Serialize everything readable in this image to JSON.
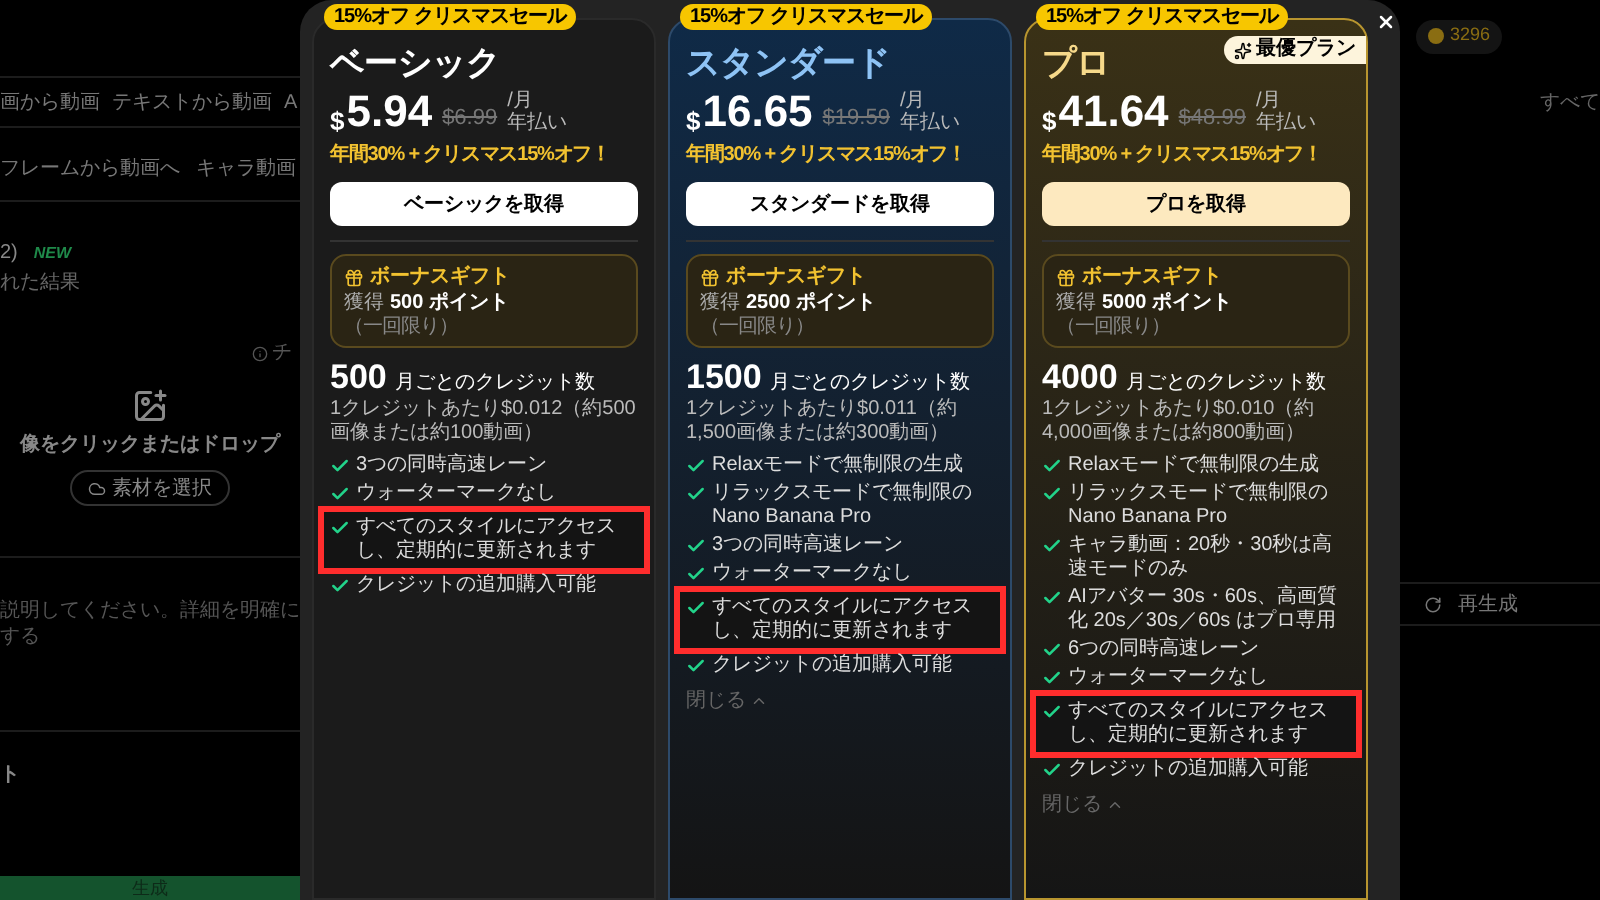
{
  "background": {
    "mode_tabs": [
      "画から動画",
      "テキストから動画",
      "A"
    ],
    "sub_tabs": [
      "フレームから動画へ",
      "キャラ動画"
    ],
    "model": {
      "name": "2)",
      "badge": "NEW",
      "note": "れた結果"
    },
    "hint": "チ",
    "upload": {
      "text": "像をクリックまたはドロップ",
      "button": "素材を選択"
    },
    "prompt": "説明してください。詳細を明確にする",
    "section": "ト",
    "generate": "生成",
    "credits": "3296",
    "filter": "すべて",
    "regenerate": "再生成"
  },
  "plans": [
    {
      "kind": "basic",
      "badge": "15%オフ クリスマスセール",
      "name": "ベーシック",
      "currency": "$",
      "price": "5.94",
      "original_price": "$6.99",
      "per": "/月",
      "billing": "年払い",
      "discount_note": "年間30% + クリスマス15%オフ！",
      "cta": "ベーシックを取得",
      "bonus": {
        "title": "ボーナスギフト",
        "prefix": "獲得",
        "amount": "500 ポイント",
        "suffix": "（一回限り）"
      },
      "credits": "500",
      "credits_label": "月ごとのクレジット数",
      "credits_note": "1クレジットあたり$0.012（約500画像または約100動画）",
      "features": [
        {
          "text": "3つの同時高速レーン",
          "highlighted": false
        },
        {
          "text": "ウォーターマークなし",
          "highlighted": false
        },
        {
          "text": "すべてのスタイルにアクセスし、定期的に更新されます",
          "highlighted": true
        },
        {
          "text": "クレジットの追加購入可能",
          "highlighted": false
        }
      ]
    },
    {
      "kind": "standard",
      "badge": "15%オフ クリスマスセール",
      "name": "スタンダード",
      "currency": "$",
      "price": "16.65",
      "original_price": "$19.59",
      "per": "/月",
      "billing": "年払い",
      "discount_note": "年間30% + クリスマス15%オフ！",
      "cta": "スタンダードを取得",
      "bonus": {
        "title": "ボーナスギフト",
        "prefix": "獲得",
        "amount": "2500 ポイント",
        "suffix": "（一回限り）"
      },
      "credits": "1500",
      "credits_label": "月ごとのクレジット数",
      "credits_note": "1クレジットあたり$0.011（約1,500画像または約300動画）",
      "features": [
        {
          "text": "Relaxモードで無制限の生成",
          "highlighted": false
        },
        {
          "text": "リラックスモードで無制限のNano Banana Pro",
          "highlighted": false
        },
        {
          "text": "3つの同時高速レーン",
          "highlighted": false
        },
        {
          "text": "ウォーターマークなし",
          "highlighted": false
        },
        {
          "text": "すべてのスタイルにアクセスし、定期的に更新されます",
          "highlighted": true
        },
        {
          "text": "クレジットの追加購入可能",
          "highlighted": false
        }
      ],
      "collapse": "閉じる"
    },
    {
      "kind": "pro",
      "badge": "15%オフ クリスマスセール",
      "ribbon": "最優プラン",
      "name": "プロ",
      "currency": "$",
      "price": "41.64",
      "original_price": "$48.99",
      "per": "/月",
      "billing": "年払い",
      "discount_note": "年間30% + クリスマス15%オフ！",
      "cta": "プロを取得",
      "bonus": {
        "title": "ボーナスギフト",
        "prefix": "獲得",
        "amount": "5000 ポイント",
        "suffix": "（一回限り）"
      },
      "credits": "4000",
      "credits_label": "月ごとのクレジット数",
      "credits_note": "1クレジットあたり$0.010（約4,000画像または約800動画）",
      "features": [
        {
          "text": "Relaxモードで無制限の生成",
          "highlighted": false
        },
        {
          "text": "リラックスモードで無制限のNano Banana Pro",
          "highlighted": false
        },
        {
          "text": "キャラ動画：20秒・30秒は高速モードのみ",
          "highlighted": false
        },
        {
          "text": "AIアバター 30s・60s、高画質化 20s／30s／60s はプロ専用",
          "highlighted": false
        },
        {
          "text": "6つの同時高速レーン",
          "highlighted": false
        },
        {
          "text": "ウォーターマークなし",
          "highlighted": false
        },
        {
          "text": "すべてのスタイルにアクセスし、定期的に更新されます",
          "highlighted": true
        },
        {
          "text": "クレジットの追加購入可能",
          "highlighted": false
        }
      ],
      "collapse": "閉じる"
    }
  ]
}
